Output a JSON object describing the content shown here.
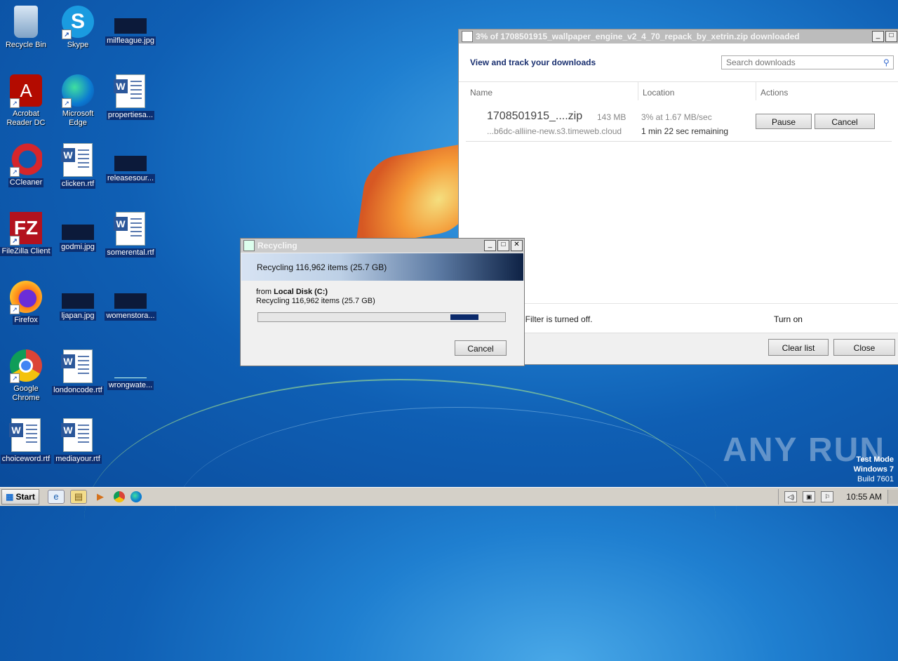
{
  "desktop": {
    "icons": [
      {
        "label": "Recycle Bin"
      },
      {
        "label": "Skype"
      },
      {
        "label": "milfleague.jpg"
      },
      {
        "label": "Acrobat Reader DC"
      },
      {
        "label": "Microsoft Edge"
      },
      {
        "label": "propertiesa..."
      },
      {
        "label": "CCleaner"
      },
      {
        "label": "clicken.rtf"
      },
      {
        "label": "releasesour..."
      },
      {
        "label": "FileZilla Client"
      },
      {
        "label": "godmi.jpg"
      },
      {
        "label": "somerental.rtf"
      },
      {
        "label": "Firefox"
      },
      {
        "label": "ljapan.jpg"
      },
      {
        "label": "womenstora..."
      },
      {
        "label": "Google Chrome"
      },
      {
        "label": "londoncode.rtf"
      },
      {
        "label": "wrongwate..."
      },
      {
        "label": "choiceword.rtf"
      },
      {
        "label": "mediayour.rtf"
      }
    ]
  },
  "downloads": {
    "title": "3% of 1708501915_wallpaper_engine_v2_4_70_repack_by_xetrin.zip downloaded",
    "heading": "View and track your downloads",
    "search_placeholder": "Search downloads",
    "columns": {
      "name": "Name",
      "location": "Location",
      "actions": "Actions"
    },
    "item": {
      "name": "1708501915_....zip",
      "size": "143 MB",
      "source": "...b6dc-alliine-new.s3.timeweb.cloud",
      "progress": "3% at 1.67 MB/sec",
      "remaining": "1 min 22 sec remaining",
      "pause_label": "Pause",
      "cancel_label": "Cancel"
    },
    "filter_text": "en Filter is turned off.",
    "turn_on_label": "Turn on",
    "clear_label": "Clear list",
    "close_label": "Close"
  },
  "recycling": {
    "title": "Recycling",
    "banner": "Recycling 116,962 items (25.7 GB)",
    "from_prefix": "from",
    "from_location": "Local Disk (C:)",
    "detail": "Recycling 116,962 items (25.7 GB)",
    "cancel_label": "Cancel"
  },
  "watermark": {
    "brand": "ANY RUN",
    "mode": "Test Mode",
    "os": "Windows 7",
    "build": "Build 7601"
  },
  "taskbar": {
    "start_label": "Start",
    "clock": "10:55 AM"
  }
}
